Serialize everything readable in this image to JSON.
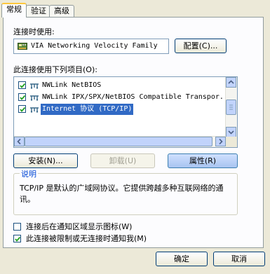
{
  "tabs": [
    {
      "label": "常规"
    },
    {
      "label": "验证"
    },
    {
      "label": "高级"
    }
  ],
  "connect_using": {
    "label": "连接时使用:",
    "adapter": "VIA Networking Velocity Family",
    "configure_button": "配置(C)..."
  },
  "components": {
    "label": "此连接使用下列项目(O):",
    "items": [
      {
        "label": "NWLink NetBIOS",
        "checked": true,
        "selected": false
      },
      {
        "label": "NWLink IPX/SPX/NetBIOS Compatible Transpor.",
        "checked": true,
        "selected": false
      },
      {
        "label": "Internet 协议 (TCP/IP)",
        "checked": true,
        "selected": true
      }
    ]
  },
  "buttons": {
    "install": "安装(N)...",
    "uninstall": "卸载(U)",
    "properties": "属性(R)"
  },
  "description": {
    "title": "说明",
    "text": "TCP/IP 是默认的广域网协议。它提供跨越多种互联网络的通讯。"
  },
  "options": {
    "show_icon": {
      "label": "连接后在通知区域显示图标(W)",
      "checked": false
    },
    "notify_limited": {
      "label": "此连接被限制或无连接时通知我(M)",
      "checked": true
    }
  },
  "dialog": {
    "ok": "确定",
    "cancel": "取消"
  },
  "colors": {
    "selection": "#316ac5",
    "group_title": "#0046d5",
    "active_tab_accent": "#ffc83c"
  }
}
